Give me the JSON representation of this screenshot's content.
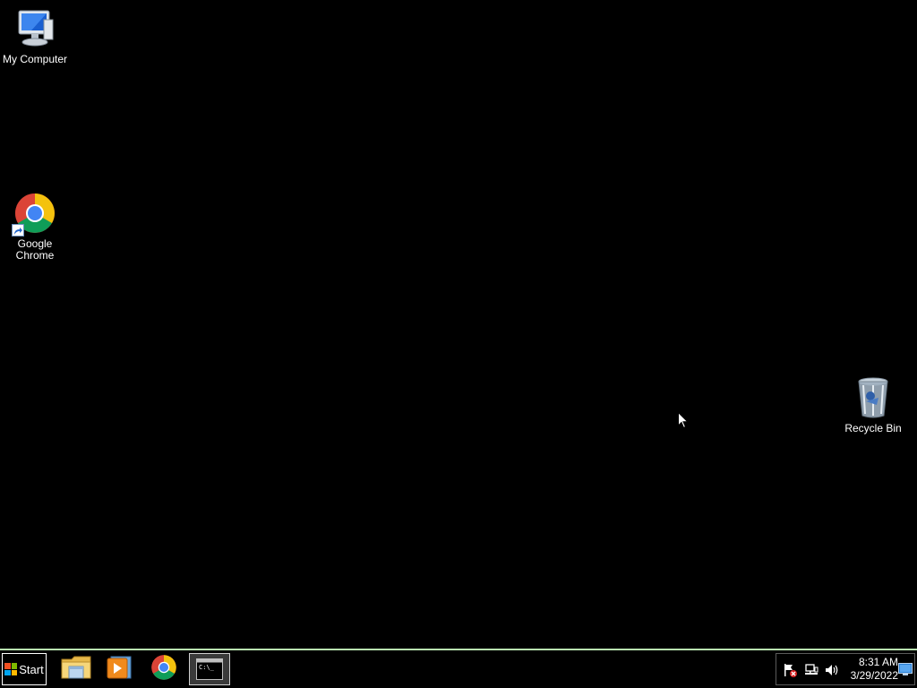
{
  "desktop": {
    "icons": [
      {
        "label": "My Computer",
        "icon": "computer-icon"
      },
      {
        "label": "Google\nChrome",
        "icon": "chrome-icon"
      },
      {
        "label": "Recycle Bin",
        "icon": "recycle-bin-icon"
      }
    ]
  },
  "taskbar": {
    "start_label": "Start",
    "pinned": [
      {
        "name": "Windows Explorer",
        "icon": "folder-icon"
      },
      {
        "name": "Windows Media Player",
        "icon": "media-player-icon"
      },
      {
        "name": "Google Chrome",
        "icon": "chrome-icon"
      },
      {
        "name": "Command Prompt",
        "icon": "cmd-icon",
        "cmd_text": "C:\\_"
      }
    ],
    "tray": {
      "icons": [
        "action-center-flag-icon",
        "network-icon",
        "volume-icon"
      ],
      "time": "8:31 AM",
      "date": "3/29/2022"
    }
  },
  "colors": {
    "desktop_bg": "#000000",
    "taskbar_border": "#b9e3b0",
    "text": "#ffffff"
  }
}
